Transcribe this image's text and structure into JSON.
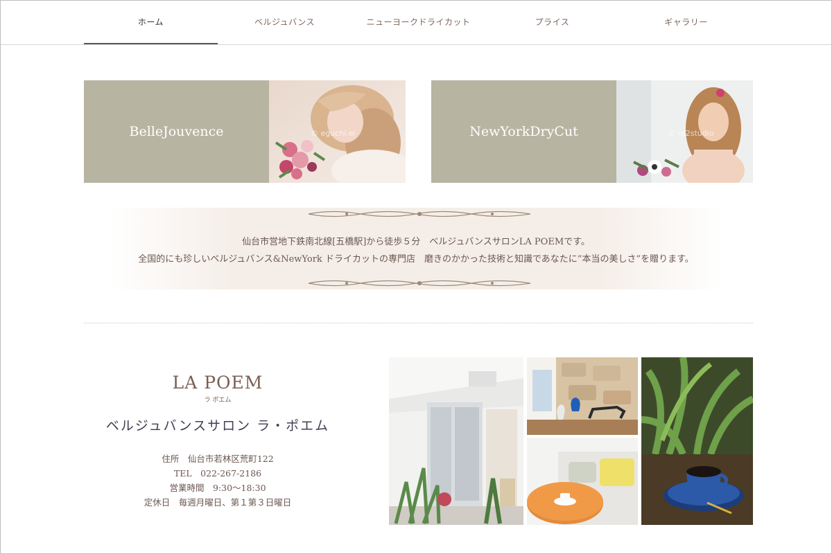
{
  "nav": {
    "items": [
      "ホーム",
      "ベルジュバンス",
      "ニューヨークドライカット",
      "プライス",
      "ギャラリー"
    ]
  },
  "banners": [
    {
      "label": "BelleJouvence",
      "watermark": "© eguchi.ei"
    },
    {
      "label": "NewYorkDryCut",
      "watermark": "© ra2studio"
    }
  ],
  "intro": {
    "line1": "仙台市営地下鉄南北線[五橋駅]から徒歩５分　ベルジュバンスサロンLA POEMです。",
    "line2": "全国的にも珍しいベルジュバンス&NewYork ドライカットの専門店　磨きのかかった技術と知識であなたに”本当の美しさ”を贈ります。"
  },
  "salon": {
    "logo": "LA POEM",
    "logo_kana": "ラ ポエム",
    "name": "ベルジュバンスサロン ラ・ポエム",
    "address": "住所　仙台市若林区荒町122",
    "tel": "TEL　022-267-2186",
    "hours": "営業時間　9:30〜18:30",
    "closed": "定休日　毎週月曜日、第１第３日曜日"
  },
  "colors": {
    "banner_bg": "#b7b4a2",
    "text": "#6b5650",
    "accent": "#7a5e52"
  }
}
